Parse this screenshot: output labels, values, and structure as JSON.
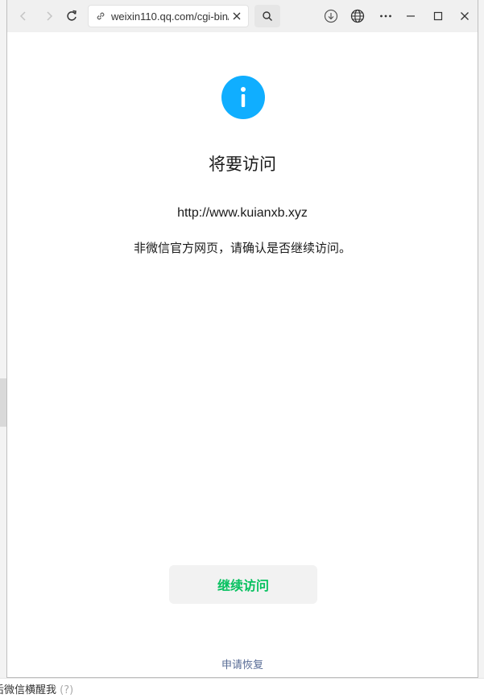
{
  "browser": {
    "url": "weixin110.qq.com/cgi-bin/"
  },
  "page": {
    "title": "将要访问",
    "url": "http://www.kuianxb.xyz",
    "description": "非微信官方网页，请确认是否继续访问。",
    "continue_label": "继续访问",
    "restore_label": "申请恢复"
  },
  "background": {
    "bottom_text": "后微信横醒我",
    "help_text": "(?)"
  },
  "colors": {
    "info_icon": "#10aeff",
    "continue_text": "#07c160",
    "link": "#576b95"
  },
  "icons": {
    "back": "back-icon",
    "forward": "forward-icon",
    "refresh": "refresh-icon",
    "link": "link-icon",
    "clear": "close-icon",
    "search": "search-icon",
    "download": "download-icon",
    "globe": "globe-icon",
    "more": "more-icon",
    "minimize": "minimize-icon",
    "maximize": "maximize-icon",
    "close": "close-icon",
    "info": "info-icon"
  }
}
